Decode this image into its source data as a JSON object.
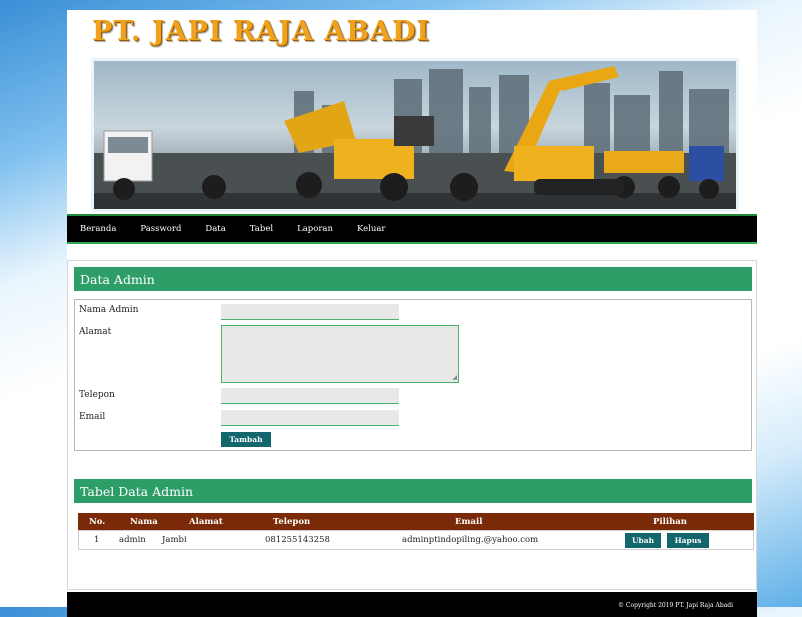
{
  "site": {
    "title": "PT. JAPI RAJA ABADI"
  },
  "nav": {
    "items": [
      "Beranda",
      "Password",
      "Data",
      "Tabel",
      "Laporan",
      "Keluar"
    ]
  },
  "form": {
    "title": "Data Admin",
    "labels": {
      "nama": "Nama Admin",
      "alamat": "Alamat",
      "telepon": "Telepon",
      "email": "Email"
    },
    "values": {
      "nama": "",
      "alamat": "",
      "telepon": "",
      "email": ""
    },
    "submit_label": "Tambah"
  },
  "table": {
    "title": "Tabel Data Admin",
    "headers": [
      "No.",
      "Nama",
      "Alamat",
      "Telepon",
      "Email",
      "Pilihan"
    ],
    "rows": [
      {
        "no": "1",
        "nama": "admin",
        "alamat": "Jambi",
        "telepon": "081255143258",
        "email": "adminptindopiling.@yahoo.com",
        "ubah": "Ubah",
        "hapus": "Hapus"
      }
    ]
  },
  "footer": {
    "copyright": "© Copyright 2019 PT. Japi Raja Abadi"
  },
  "colors": {
    "title": "#f0a21c",
    "nav_bg": "#000000",
    "section_header": "#2e9e69",
    "table_header": "#7a2a06",
    "button": "#13666b"
  }
}
